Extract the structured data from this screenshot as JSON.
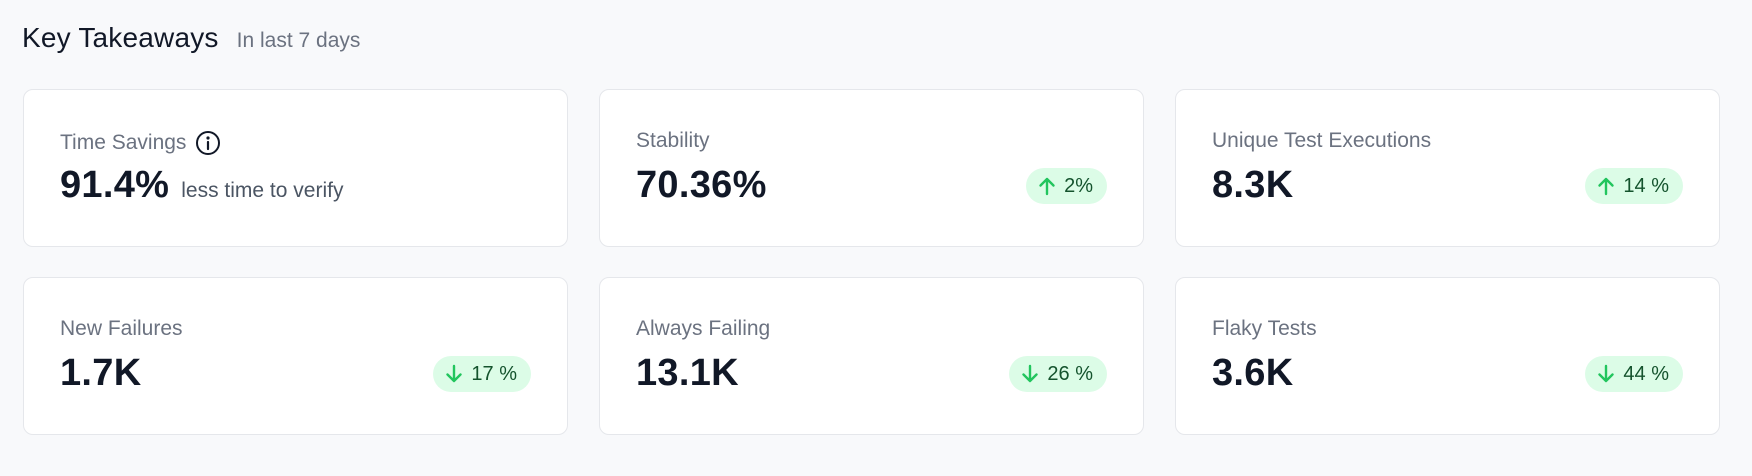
{
  "header": {
    "title": "Key Takeaways",
    "subtitle": "In last 7 days"
  },
  "colors": {
    "badge_bg": "#dcfce7",
    "badge_arrow": "#22c55e",
    "badge_text": "#14532d"
  },
  "cards": [
    {
      "label": "Time Savings",
      "value": "91.4%",
      "suffix": "less time to verify",
      "info_icon": "info-icon"
    },
    {
      "label": "Stability",
      "value": "70.36%",
      "badge": {
        "direction": "up",
        "icon": "arrow-up-icon",
        "text": "2%"
      }
    },
    {
      "label": "Unique Test Executions",
      "value": "8.3K",
      "badge": {
        "direction": "up",
        "icon": "arrow-up-icon",
        "text": "14 %"
      }
    },
    {
      "label": "New Failures",
      "value": "1.7K",
      "badge": {
        "direction": "down",
        "icon": "arrow-down-icon",
        "text": "17 %"
      }
    },
    {
      "label": "Always Failing",
      "value": "13.1K",
      "badge": {
        "direction": "down",
        "icon": "arrow-down-icon",
        "text": "26 %"
      }
    },
    {
      "label": "Flaky Tests",
      "value": "3.6K",
      "badge": {
        "direction": "down",
        "icon": "arrow-down-icon",
        "text": "44 %"
      }
    }
  ]
}
